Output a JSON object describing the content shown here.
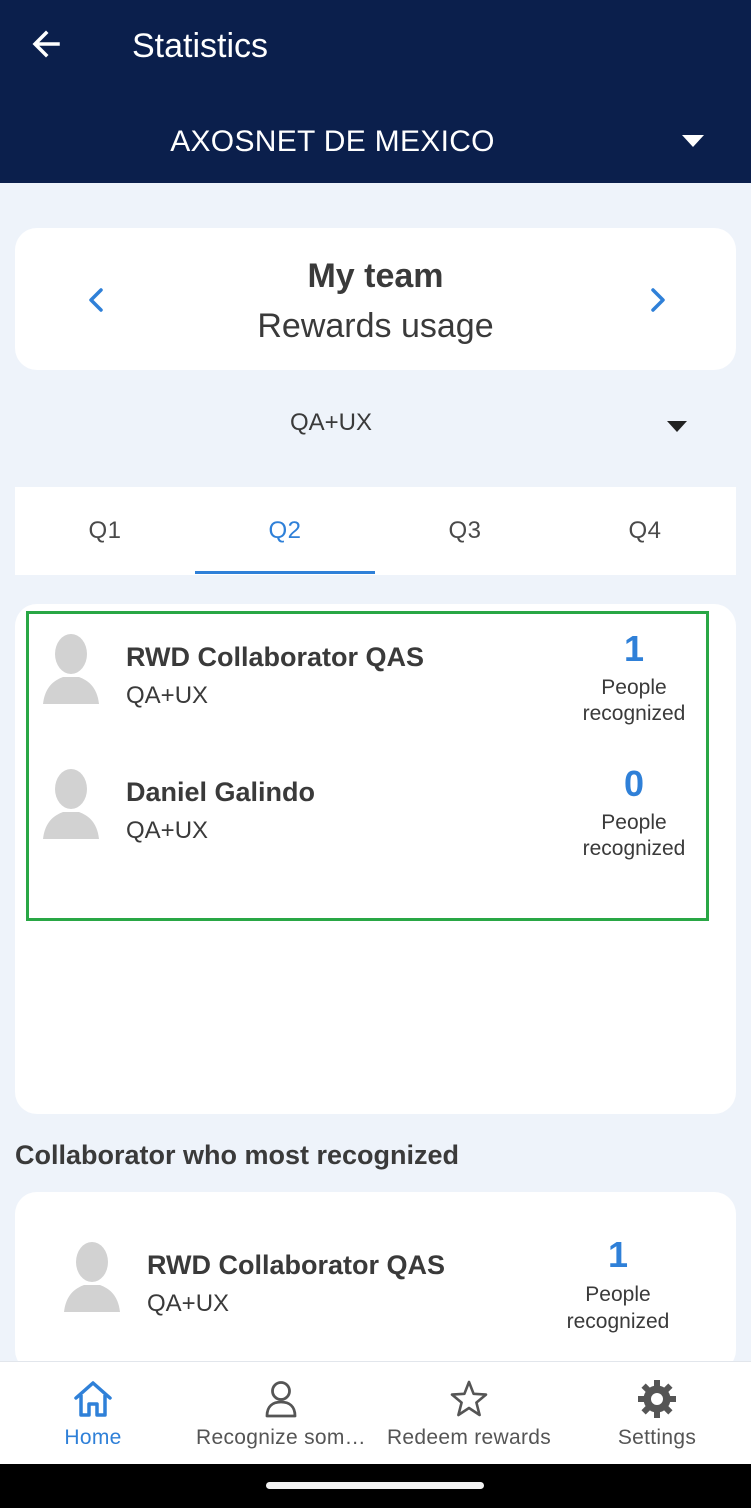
{
  "header": {
    "title": "Statistics",
    "organization": "AXOSNET DE MEXICO"
  },
  "team_card": {
    "title": "My team",
    "subtitle": "Rewards usage"
  },
  "group_filter": {
    "selected": "QA+UX"
  },
  "quarter_tabs": {
    "items": [
      {
        "label": "Q1"
      },
      {
        "label": "Q2"
      },
      {
        "label": "Q3"
      },
      {
        "label": "Q4"
      }
    ],
    "active": "Q2"
  },
  "team_members": [
    {
      "name": "RWD Collaborator QAS",
      "group": "QA+UX",
      "count": "1",
      "label_line1": "People",
      "label_line2": "recognized"
    },
    {
      "name": "Daniel Galindo",
      "group": "QA+UX",
      "count": "0",
      "label_line1": "People",
      "label_line2": "recognized"
    }
  ],
  "top_section": {
    "title": "Collaborator who most recognized",
    "member": {
      "name": "RWD Collaborator QAS",
      "group": "QA+UX",
      "count": "1",
      "label_line1": "People",
      "label_line2": "recognized"
    }
  },
  "bottom_nav": {
    "items": [
      {
        "label": "Home",
        "icon": "home-icon"
      },
      {
        "label": "Recognize som…",
        "icon": "person-icon"
      },
      {
        "label": "Redeem rewards",
        "icon": "star-icon"
      },
      {
        "label": "Settings",
        "icon": "gear-icon"
      }
    ],
    "active": "Home"
  },
  "colors": {
    "header_bg": "#0b1f4c",
    "accent": "#2f80d8",
    "highlight_border": "#29a745",
    "page_bg": "#eef3fa"
  }
}
